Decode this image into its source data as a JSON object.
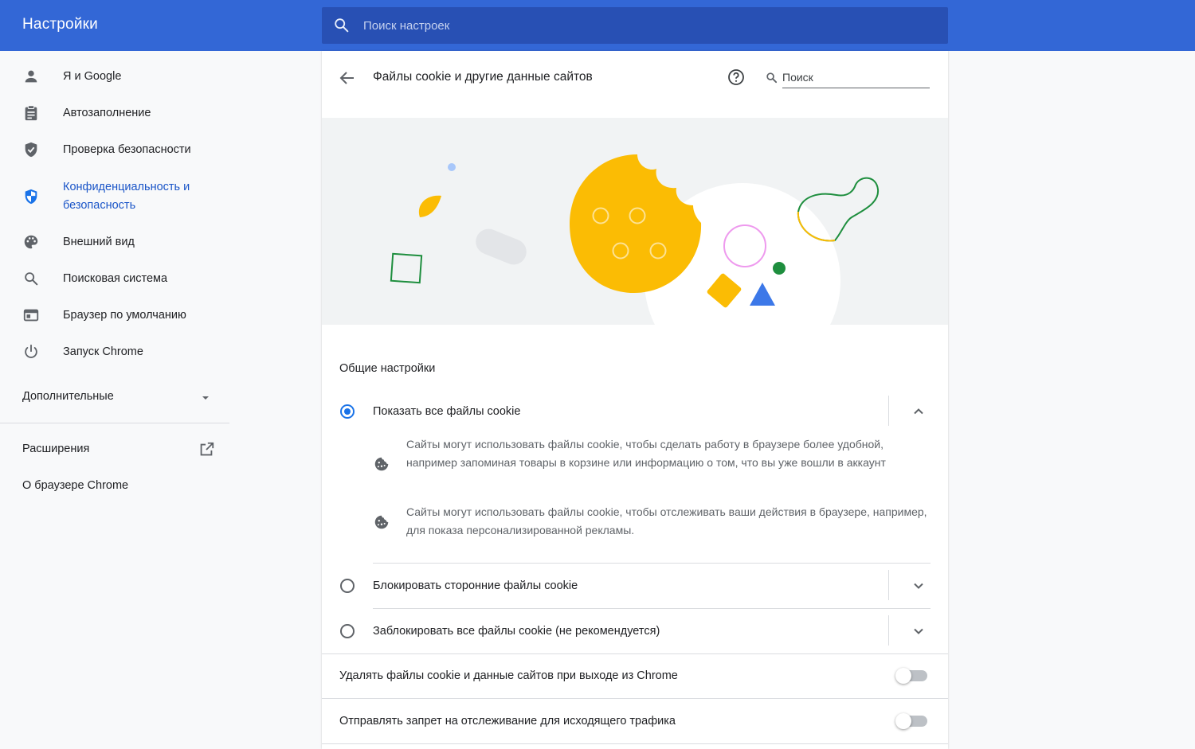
{
  "header": {
    "title": "Настройки",
    "search_placeholder": "Поиск настроек"
  },
  "sidebar": {
    "items": [
      {
        "label": "Я и Google",
        "icon": "person-icon"
      },
      {
        "label": "Автозаполнение",
        "icon": "clipboard-icon"
      },
      {
        "label": "Проверка безопасности",
        "icon": "shield-check-icon"
      },
      {
        "label": "Конфиденциальность и безопасность",
        "icon": "security-shield-icon",
        "active": true
      },
      {
        "label": "Внешний вид",
        "icon": "palette-icon"
      },
      {
        "label": "Поисковая система",
        "icon": "search-icon"
      },
      {
        "label": "Браузер по умолчанию",
        "icon": "browser-window-icon"
      },
      {
        "label": "Запуск Chrome",
        "icon": "power-icon"
      }
    ],
    "advanced_label": "Дополнительные",
    "extensions_label": "Расширения",
    "about_label": "О браузере Chrome"
  },
  "page": {
    "title": "Файлы cookie и другие данные сайтов",
    "search_placeholder": "Поиск",
    "section_title": "Общие настройки",
    "options": [
      {
        "label": "Показать все файлы cookie",
        "selected": true,
        "expanded": true
      },
      {
        "label": "Блокировать сторонние файлы cookie",
        "selected": false,
        "expanded": false
      },
      {
        "label": "Заблокировать все файлы cookie (не рекомендуется)",
        "selected": false,
        "expanded": false
      }
    ],
    "descriptions": [
      "Сайты могут использовать файлы cookie, чтобы сделать работу в браузере более удобной, например запоминая товары в корзине или информацию о том, что вы уже вошли в аккаунт",
      "Сайты могут использовать файлы cookie, чтобы отслеживать ваши действия в браузере, например, для показа персонализированной рекламы."
    ],
    "toggles": [
      {
        "label": "Удалять файлы cookie и данные сайтов при выходе из Chrome",
        "on": false
      },
      {
        "label": "Отправлять запрет на отслеживание для исходящего трафика",
        "on": false
      }
    ]
  },
  "colors": {
    "topbar": "#3367d6",
    "accent": "#1a73e8",
    "cookie_yellow": "#fbbc04",
    "green": "#1e8e3e"
  }
}
